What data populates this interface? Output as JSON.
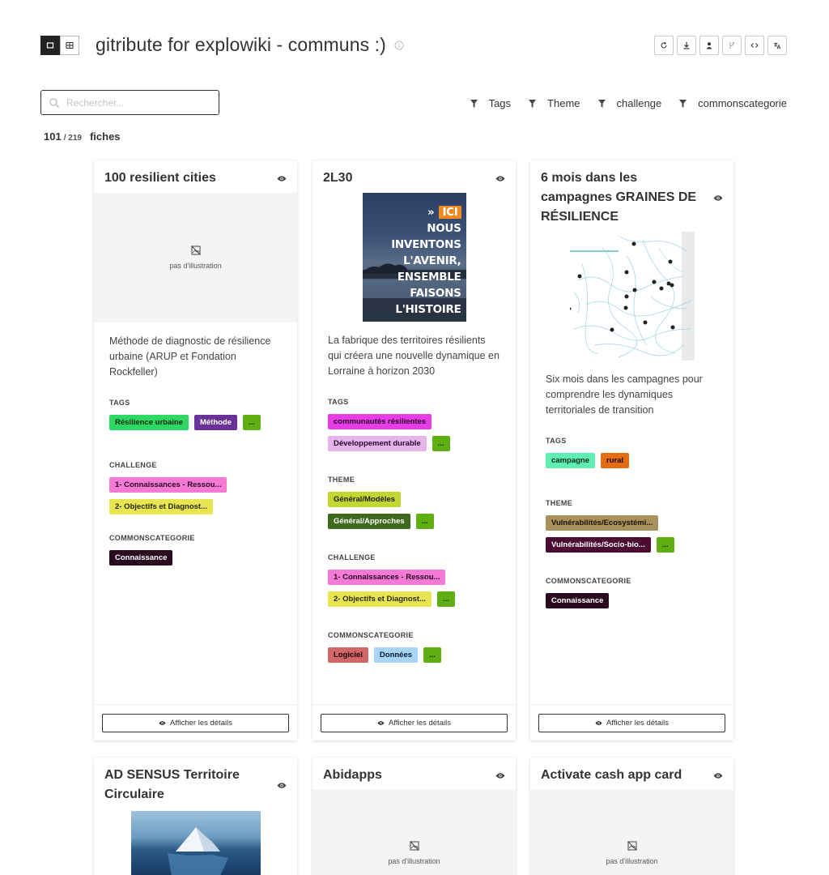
{
  "header": {
    "title": "gitribute for explowiki - communs :)",
    "view_modes": [
      "cards-view-icon",
      "table-view-icon"
    ],
    "actions": [
      "reload-icon",
      "download-icon",
      "user-icon",
      "git-branch-icon",
      "code-icon",
      "translate-icon"
    ]
  },
  "search": {
    "placeholder": "Rechercher..."
  },
  "filters": [
    "Tags",
    "Theme",
    "challenge",
    "commonscategorie"
  ],
  "count": {
    "shown": "101",
    "total": "/ 219",
    "label": "fiches"
  },
  "labels": {
    "no_image": "pas d'illustration",
    "details": "Afficher les détails",
    "tags": "TAGS",
    "theme": "THEME",
    "challenge": "CHALLENGE",
    "commonscategorie": "COMMONSCATEGORIE",
    "more": "..."
  },
  "cards": [
    {
      "title": "100 resilient cities",
      "description": "Méthode de diagnostic de résilience urbaine (ARUP et Fondation Rockfeller)",
      "tags": [
        {
          "label": "Résilience urbaine",
          "bg": "#2ed863",
          "fg": "#0a2a10"
        },
        {
          "label": "Méthode",
          "bg": "#6a3199",
          "fg": "#ffffff"
        },
        {
          "label": "...",
          "bg": "#5fae12",
          "fg": "#0a2a00"
        }
      ],
      "challenge": [
        {
          "label": "1- Connaissances - Ressou...",
          "bg": "#f47ad6",
          "fg": "#2a0020"
        },
        {
          "label": "2- Objectifs et Diagnost...",
          "bg": "#e7e552",
          "fg": "#2a2a00"
        }
      ],
      "commonscategorie": [
        {
          "label": "Connaissance",
          "bg": "#2a0a1e",
          "fg": "#ffffff"
        }
      ]
    },
    {
      "title": "2L30",
      "image_text": [
        "ICI",
        "NOUS",
        "INVENTONS",
        "L'AVENIR,",
        "ENSEMBLE",
        "FAISONS",
        "L'HISTOIRE"
      ],
      "description": "La fabrique des territoires résilients qui créera une nouvelle dynamique en Lorraine à horizon 2030",
      "tags": [
        {
          "label": "communautés résilientes",
          "bg": "#e63de6",
          "fg": "#2a002a"
        },
        {
          "label": "Développement durable",
          "bg": "#e5b4e9",
          "fg": "#2a0030"
        },
        {
          "label": "...",
          "bg": "#5fae12",
          "fg": "#0a2a00"
        }
      ],
      "theme": [
        {
          "label": "Général/Modèles",
          "bg": "#c3d632",
          "fg": "#1a2000"
        },
        {
          "label": "Général/Approches",
          "bg": "#3f6a1e",
          "fg": "#ffffff"
        },
        {
          "label": "...",
          "bg": "#5fae12",
          "fg": "#0a2a00"
        }
      ],
      "challenge": [
        {
          "label": "1- Connaissances - Ressou...",
          "bg": "#f47ad6",
          "fg": "#2a0020"
        },
        {
          "label": "2- Objectifs et Diagnost...",
          "bg": "#e7e552",
          "fg": "#2a2a00"
        },
        {
          "label": "...",
          "bg": "#5fae12",
          "fg": "#0a2a00"
        }
      ],
      "commonscategorie": [
        {
          "label": "Logiciel",
          "bg": "#d26565",
          "fg": "#1a0000"
        },
        {
          "label": "Données",
          "bg": "#a9d4f5",
          "fg": "#001a30"
        },
        {
          "label": "...",
          "bg": "#5fae12",
          "fg": "#0a2a00"
        }
      ]
    },
    {
      "title": "6 mois dans les campagnes GRAINES DE RÉSILIENCE",
      "description": "Six mois dans les campagnes pour comprendre les dynamiques territoriales de transition",
      "tags": [
        {
          "label": "campagne",
          "bg": "#5fefb0",
          "fg": "#002a1a"
        },
        {
          "label": "rural",
          "bg": "#e36c14",
          "fg": "#1a0a00"
        }
      ],
      "theme": [
        {
          "label": "Vulnérabilités/Ecosystémi...",
          "bg": "#a8915a",
          "fg": "#1a1000"
        },
        {
          "label": "Vulnérabilités/Socio-bio...",
          "bg": "#4a0a32",
          "fg": "#ffffff"
        },
        {
          "label": "...",
          "bg": "#5fae12",
          "fg": "#0a2a00"
        }
      ],
      "commonscategorie": [
        {
          "label": "Connaissance",
          "bg": "#2a0a1e",
          "fg": "#ffffff"
        }
      ]
    },
    {
      "title": "AD SENSUS Territoire Circulaire"
    },
    {
      "title": "Abidapps"
    },
    {
      "title": "Activate cash app card"
    }
  ]
}
